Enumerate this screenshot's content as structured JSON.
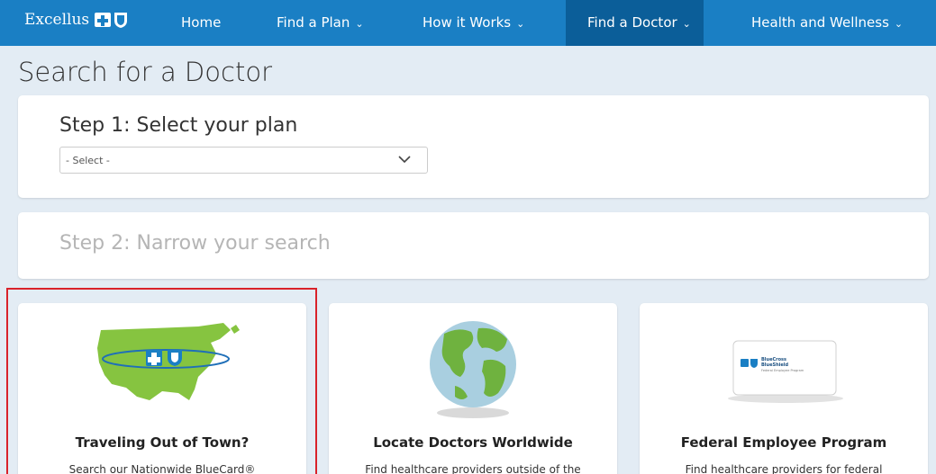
{
  "nav": {
    "logo_text": "Excellus",
    "items": [
      {
        "label": "Home"
      },
      {
        "label": "Find a Plan"
      },
      {
        "label": "How it Works"
      },
      {
        "label": "Find a Doctor"
      },
      {
        "label": "Health and Wellness"
      }
    ],
    "active_item": "Find a Doctor",
    "chevron": "⌄"
  },
  "page_title": "Search for a Doctor",
  "step1": {
    "title": "Step 1: Select your plan",
    "select_value": "- Select -"
  },
  "step2": {
    "title": "Step 2: Narrow your search"
  },
  "cards": [
    {
      "title": "Traveling Out of Town?",
      "desc": "Search our Nationwide BlueCard®",
      "icon": "us-map-icon"
    },
    {
      "title": "Locate Doctors Worldwide",
      "desc": "Find healthcare providers outside of the",
      "icon": "globe-icon"
    },
    {
      "title": "Federal Employee Program",
      "desc": "Find healthcare providers for federal",
      "icon": "fep-card-icon"
    }
  ],
  "fep_card_text": {
    "line1": "BlueCross",
    "line2": "BlueShield",
    "line3": "Federal Employee Program"
  },
  "colors": {
    "nav_bg": "#1a7fc4",
    "nav_active_bg": "#0b5e99",
    "page_bg": "#e3ecf4",
    "highlight_border": "#d9222a",
    "map_green": "#86c440",
    "globe_blue": "#a9cfe0"
  }
}
